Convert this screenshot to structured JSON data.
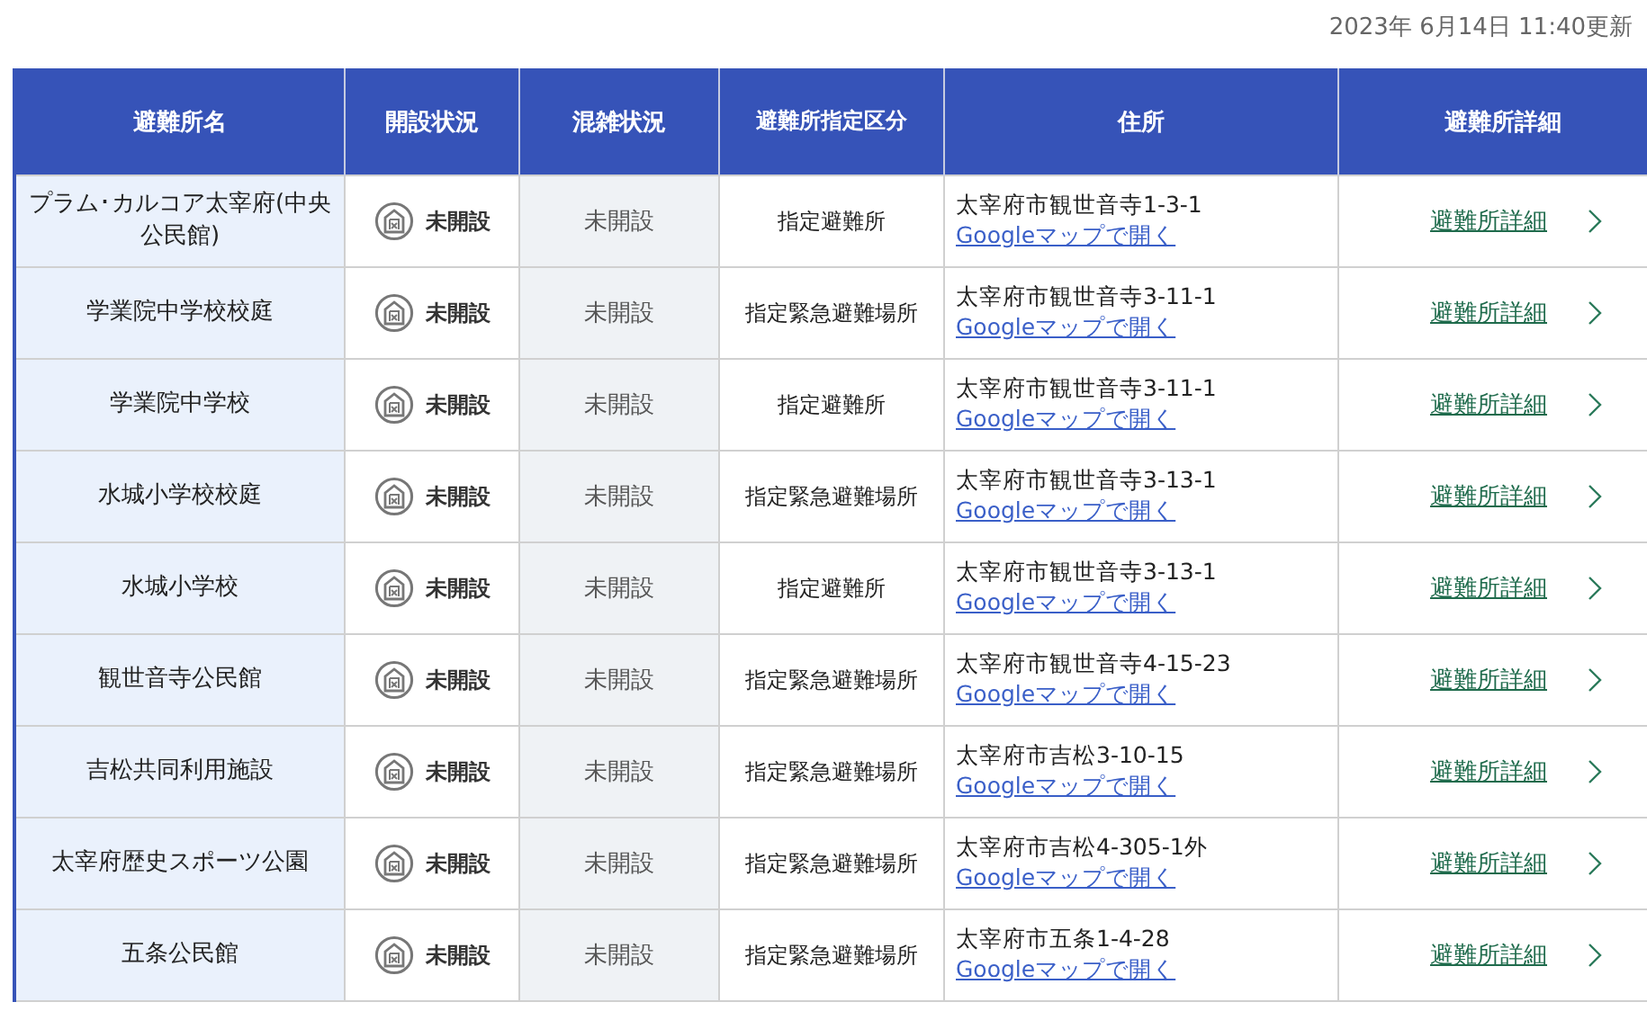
{
  "updated": "2023年 6月14日 11:40更新",
  "table": {
    "columns": [
      "避難所名",
      "開設状況",
      "混雑状況",
      "避難所指定区分",
      "住所",
      "避難所詳細"
    ],
    "rows": [
      {
        "name": "プラム･カルコア太宰府(中央公民館)",
        "status": "未開設",
        "congestion": "未開設",
        "category": "指定避難所",
        "address": "太宰府市観世音寺1-3-1",
        "map_link": "Googleマップで開く",
        "detail_link": "避難所詳細"
      },
      {
        "name": "学業院中学校校庭",
        "status": "未開設",
        "congestion": "未開設",
        "category": "指定緊急避難場所",
        "address": "太宰府市観世音寺3-11-1",
        "map_link": "Googleマップで開く",
        "detail_link": "避難所詳細"
      },
      {
        "name": "学業院中学校",
        "status": "未開設",
        "congestion": "未開設",
        "category": "指定避難所",
        "address": "太宰府市観世音寺3-11-1",
        "map_link": "Googleマップで開く",
        "detail_link": "避難所詳細"
      },
      {
        "name": "水城小学校校庭",
        "status": "未開設",
        "congestion": "未開設",
        "category": "指定緊急避難場所",
        "address": "太宰府市観世音寺3-13-1",
        "map_link": "Googleマップで開く",
        "detail_link": "避難所詳細"
      },
      {
        "name": "水城小学校",
        "status": "未開設",
        "congestion": "未開設",
        "category": "指定避難所",
        "address": "太宰府市観世音寺3-13-1",
        "map_link": "Googleマップで開く",
        "detail_link": "避難所詳細"
      },
      {
        "name": "観世音寺公民館",
        "status": "未開設",
        "congestion": "未開設",
        "category": "指定緊急避難場所",
        "address": "太宰府市観世音寺4-15-23",
        "map_link": "Googleマップで開く",
        "detail_link": "避難所詳細"
      },
      {
        "name": "吉松共同利用施設",
        "status": "未開設",
        "congestion": "未開設",
        "category": "指定緊急避難場所",
        "address": "太宰府市吉松3-10-15",
        "map_link": "Googleマップで開く",
        "detail_link": "避難所詳細"
      },
      {
        "name": "太宰府歴史スポーツ公園",
        "status": "未開設",
        "congestion": "未開設",
        "category": "指定緊急避難場所",
        "address": "太宰府市吉松4-305-1外",
        "map_link": "Googleマップで開く",
        "detail_link": "避難所詳細"
      },
      {
        "name": "五条公民館",
        "status": "未開設",
        "congestion": "未開設",
        "category": "指定緊急避難場所",
        "address": "太宰府市五条1-4-28",
        "map_link": "Googleマップで開く",
        "detail_link": "避難所詳細"
      }
    ]
  }
}
